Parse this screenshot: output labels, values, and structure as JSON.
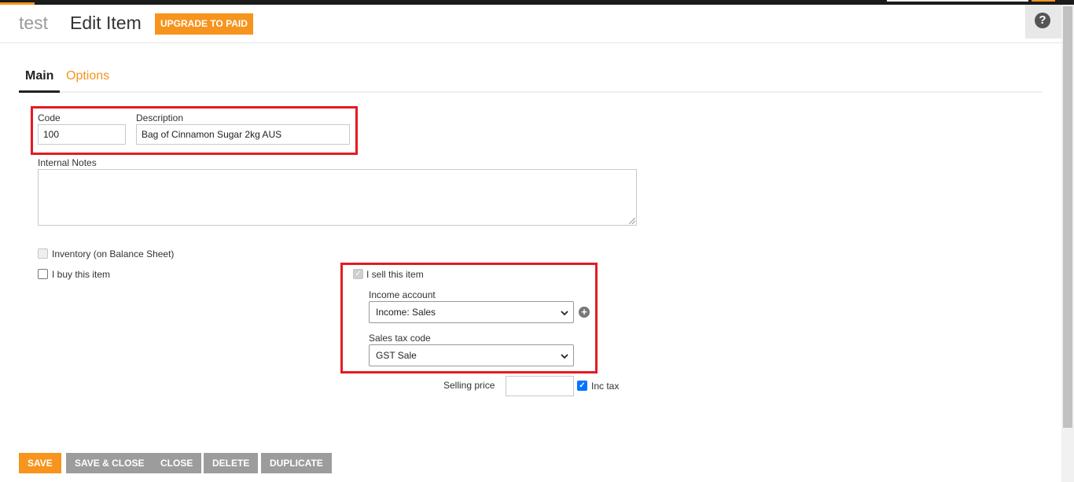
{
  "colors": {
    "accent": "#f7941d",
    "highlight": "#e31b23",
    "secondary_button": "#9c9c9c"
  },
  "header": {
    "breadcrumb": "test",
    "title": "Edit Item",
    "upgrade_label": "UPGRADE TO PAID",
    "help_icon": "?"
  },
  "tabs": [
    {
      "label": "Main",
      "active": true
    },
    {
      "label": "Options",
      "active": false
    }
  ],
  "form": {
    "code": {
      "label": "Code",
      "value": "100"
    },
    "description": {
      "label": "Description",
      "value": "Bag of Cinnamon Sugar 2kg AUS"
    },
    "internal_notes": {
      "label": "Internal Notes",
      "value": ""
    },
    "inventory": {
      "label": "Inventory (on Balance Sheet)",
      "checked": false,
      "disabled": true
    },
    "buy": {
      "label": "I buy this item",
      "checked": false
    },
    "sell": {
      "label": "I sell this item",
      "checked": true,
      "disabled": true
    },
    "income_account": {
      "label": "Income account",
      "value": "Income: Sales"
    },
    "sales_tax_code": {
      "label": "Sales tax code",
      "value": "GST Sale"
    },
    "selling_price": {
      "label": "Selling price",
      "value": ""
    },
    "inc_tax": {
      "label": "Inc tax",
      "checked": true
    }
  },
  "actions": {
    "save": "SAVE",
    "save_close": "SAVE & CLOSE",
    "close": "CLOSE",
    "delete": "DELETE",
    "duplicate": "DUPLICATE"
  }
}
